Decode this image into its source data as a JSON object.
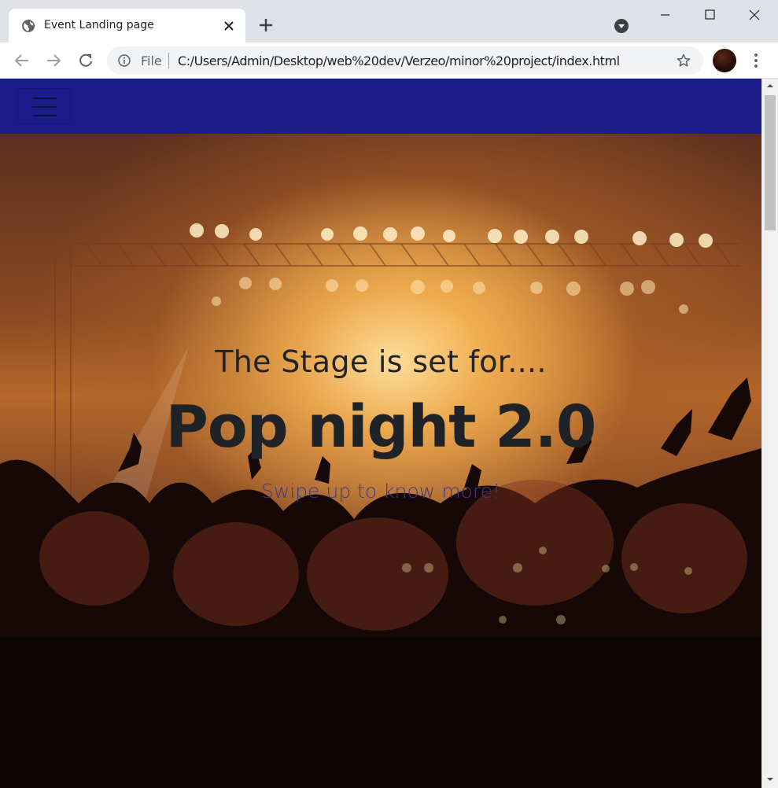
{
  "browser": {
    "tab_title": "Event Landing page",
    "url_scheme": "File",
    "url": "C:/Users/Admin/Desktop/web%20dev/Verzeo/minor%20project/index.html",
    "icons": [
      "globe-icon",
      "close-icon",
      "plus-icon",
      "search-tabs-icon",
      "minimize-icon",
      "maximize-icon",
      "window-close-icon",
      "back-icon",
      "forward-icon",
      "reload-icon",
      "info-icon",
      "star-icon",
      "avatar",
      "more-menu-icon"
    ]
  },
  "page": {
    "navbar_color": "#1a1c8a",
    "navbar_toggle_icon": "hamburger-icon",
    "hero": {
      "eyebrow": "The Stage is set for....",
      "headline": "Pop night 2.0",
      "subline": "Swipe up to know more!"
    }
  },
  "scrollbar": {
    "position_fraction": 0.0
  }
}
